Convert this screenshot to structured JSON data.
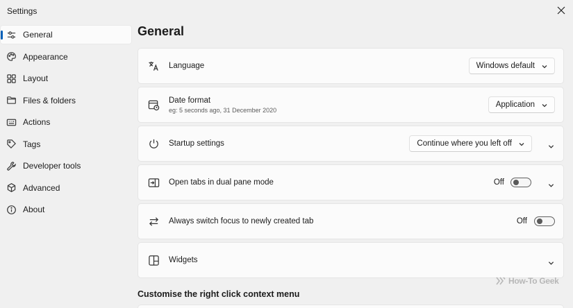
{
  "window": {
    "title": "Settings"
  },
  "sidebar": {
    "items": [
      {
        "label": "General",
        "icon": "sliders-icon"
      },
      {
        "label": "Appearance",
        "icon": "palette-icon"
      },
      {
        "label": "Layout",
        "icon": "grid-icon"
      },
      {
        "label": "Files & folders",
        "icon": "folder-icon"
      },
      {
        "label": "Actions",
        "icon": "keyboard-icon"
      },
      {
        "label": "Tags",
        "icon": "tag-icon"
      },
      {
        "label": "Developer tools",
        "icon": "wrench-icon"
      },
      {
        "label": "Advanced",
        "icon": "cube-icon"
      },
      {
        "label": "About",
        "icon": "info-icon"
      }
    ],
    "active": "General"
  },
  "main": {
    "title": "General",
    "language": {
      "label": "Language",
      "value": "Windows default"
    },
    "date_format": {
      "label": "Date format",
      "sublabel": "eg: 5 seconds ago, 31 December 2020",
      "value": "Application"
    },
    "startup": {
      "label": "Startup settings",
      "value": "Continue where you left off"
    },
    "dual_pane": {
      "label": "Open tabs in dual pane mode",
      "state": "Off"
    },
    "switch_focus": {
      "label": "Always switch focus to newly created tab",
      "state": "Off"
    },
    "widgets": {
      "label": "Widgets"
    },
    "context_menu_section": "Customise the right click context menu"
  },
  "watermark": {
    "text": "How-To Geek"
  }
}
